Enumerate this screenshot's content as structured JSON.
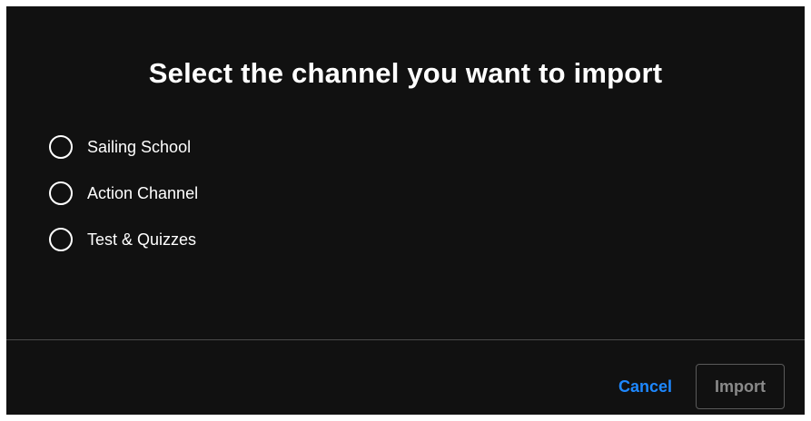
{
  "dialog": {
    "title": "Select the channel you want to import",
    "options": [
      {
        "label": "Sailing School",
        "selected": false
      },
      {
        "label": "Action Channel",
        "selected": false
      },
      {
        "label": "Test & Quizzes",
        "selected": false
      }
    ],
    "cancel_label": "Cancel",
    "import_label": "Import",
    "import_enabled": false
  },
  "colors": {
    "background": "#111111",
    "accent": "#1e88ff",
    "disabled_text": "#8a8a8a",
    "divider": "#4a4a4a"
  }
}
